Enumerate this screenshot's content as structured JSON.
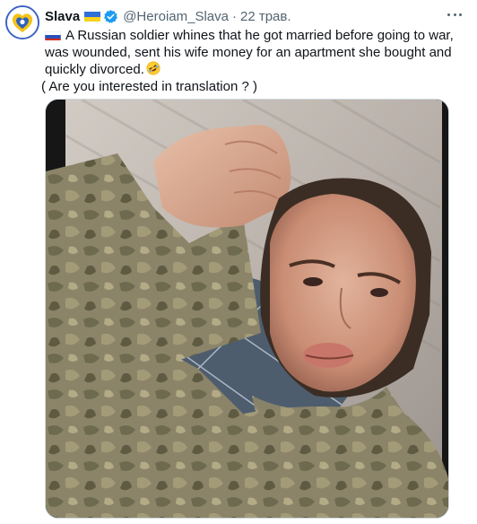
{
  "tweet": {
    "display_name": "Slava",
    "handle": "@Heroiam_Slava",
    "separator": "·",
    "date": "22 трав.",
    "text_line1": "A Russian soldier whines that he got married before going to war, was wounded, sent his wife money for an apartment she bought and quickly divorced.",
    "text_line2": "( Are you interested in translation ? )",
    "icons": {
      "name_flag": "ukraine-flag-icon",
      "verified": "verified-badge-icon",
      "text_flag": "russia-flag-icon",
      "emoji": "rolling-on-floor-laughing-emoji",
      "more": "more-options-icon"
    },
    "colors": {
      "verified": "#1d9bf0",
      "secondary_text": "#536471",
      "avatar_ring": "#3a63c4"
    }
  }
}
